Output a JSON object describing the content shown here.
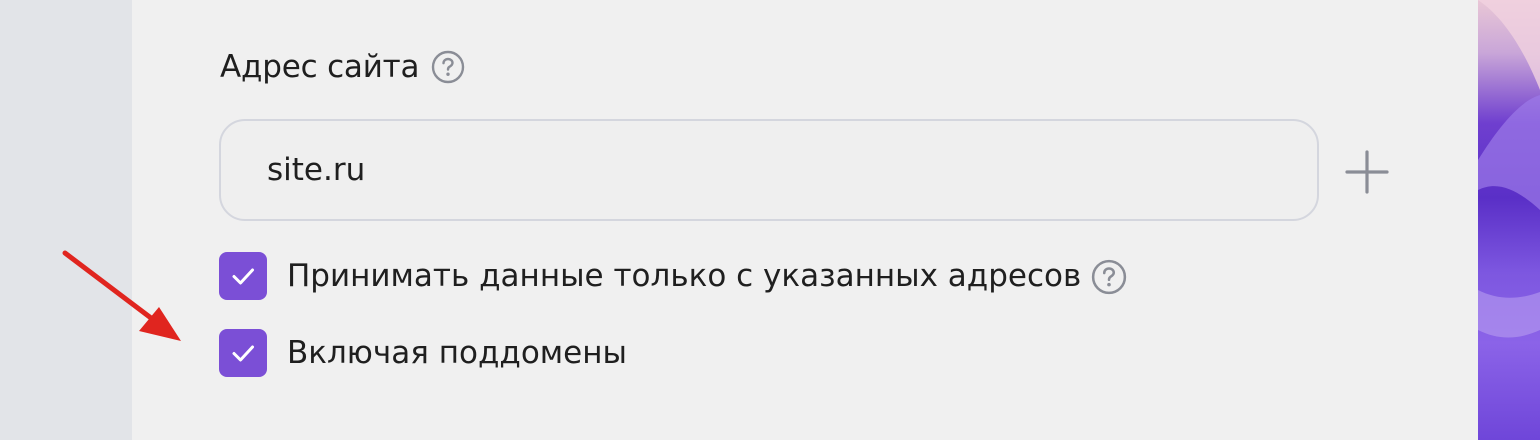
{
  "site_address": {
    "label": "Адрес сайта",
    "value": "site.ru"
  },
  "options": [
    {
      "label": "Принимать данные только с указанных адресов",
      "checked": true
    },
    {
      "label": "Включая поддомены",
      "checked": true
    }
  ],
  "colors": {
    "accent": "#7b4fd6",
    "annotation_arrow": "#e0251f",
    "panel_bg": "#f0f0f0",
    "input_border": "#d4d6de"
  }
}
